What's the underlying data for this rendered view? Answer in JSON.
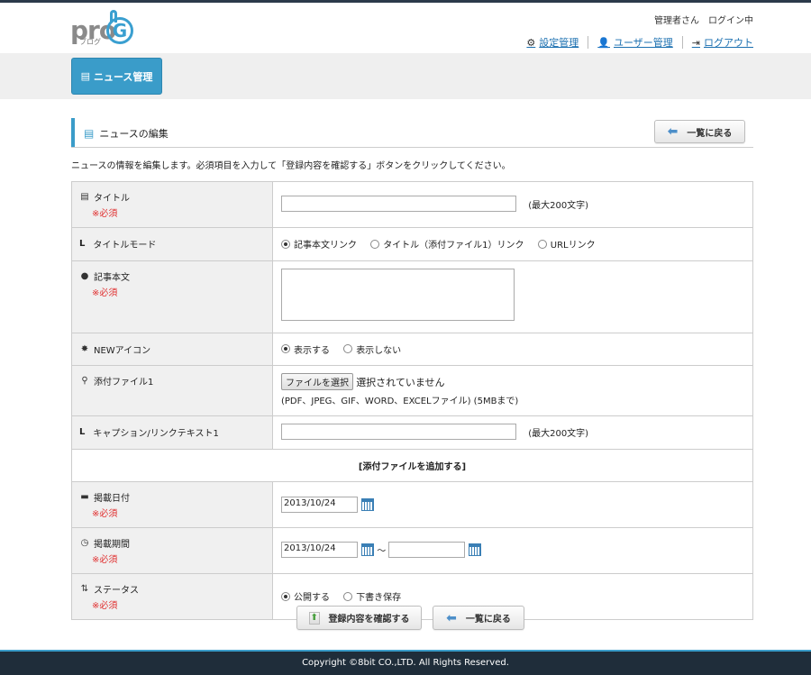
{
  "header": {
    "logo_text": "pro",
    "logo_sub": "ブログ",
    "logo_letter": "G",
    "user_status": "管理者さん　ログイン中",
    "nav": [
      {
        "label": "設定管理",
        "icon": "gear-icon"
      },
      {
        "label": "ユーザー管理",
        "icon": "user-icon"
      },
      {
        "label": "ログアウト",
        "icon": "logout-icon"
      }
    ]
  },
  "menu": {
    "news_label": "ニュース管理"
  },
  "section": {
    "title": "ニュースの編集",
    "back_label": "一覧に戻る",
    "description": "ニュースの情報を編集します。必須項目を入力して「登録内容を確認する」ボタンをクリックしてください。"
  },
  "form": {
    "required": "※必須",
    "title_label": "タイトル",
    "title_note": "(最大200文字)",
    "title_mode_label": "タイトルモード",
    "title_mode_options": [
      "記事本文リンク",
      "タイトル（添付ファイル1）リンク",
      "URLリンク"
    ],
    "body_label": "記事本文",
    "new_icon_label": "NEWアイコン",
    "new_icon_options": [
      "表示する",
      "表示しない"
    ],
    "attach_label": "添付ファイル1",
    "file_button": "ファイルを選択",
    "file_none": "選択されていません",
    "file_note": "(PDF、JPEG、GIF、WORD、EXCELファイル) (5MBまで)",
    "caption_label": "キャプション/リンクテキスト1",
    "caption_note": "(最大200文字)",
    "add_attach": "[添付ファイルを追加する]",
    "post_date_label": "掲載日付",
    "post_date_value": "2013/10/24",
    "period_label": "掲載期間",
    "period_start": "2013/10/24",
    "period_sep": "～",
    "period_end": "",
    "status_label": "ステータス",
    "status_options": [
      "公開する",
      "下書き保存"
    ]
  },
  "buttons": {
    "confirm": "登録内容を確認する",
    "back": "一覧に戻る"
  },
  "footer": {
    "copyright": "Copyright ©8bit CO.,LTD. All Rights Reserved."
  }
}
